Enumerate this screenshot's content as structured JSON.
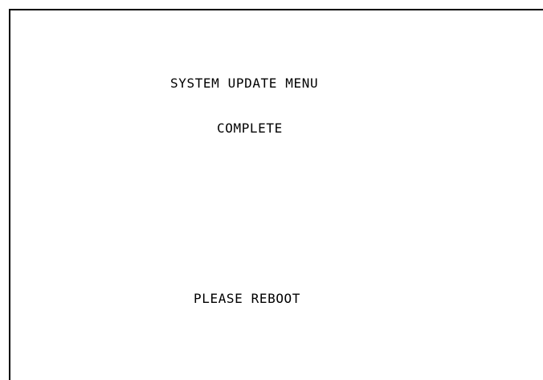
{
  "screen": {
    "title": "SYSTEM UPDATE MENU",
    "status": "COMPLETE",
    "prompt": "PLEASE REBOOT"
  },
  "colors": {
    "background": "#ffffff",
    "text": "#000000",
    "border": "#000000"
  }
}
